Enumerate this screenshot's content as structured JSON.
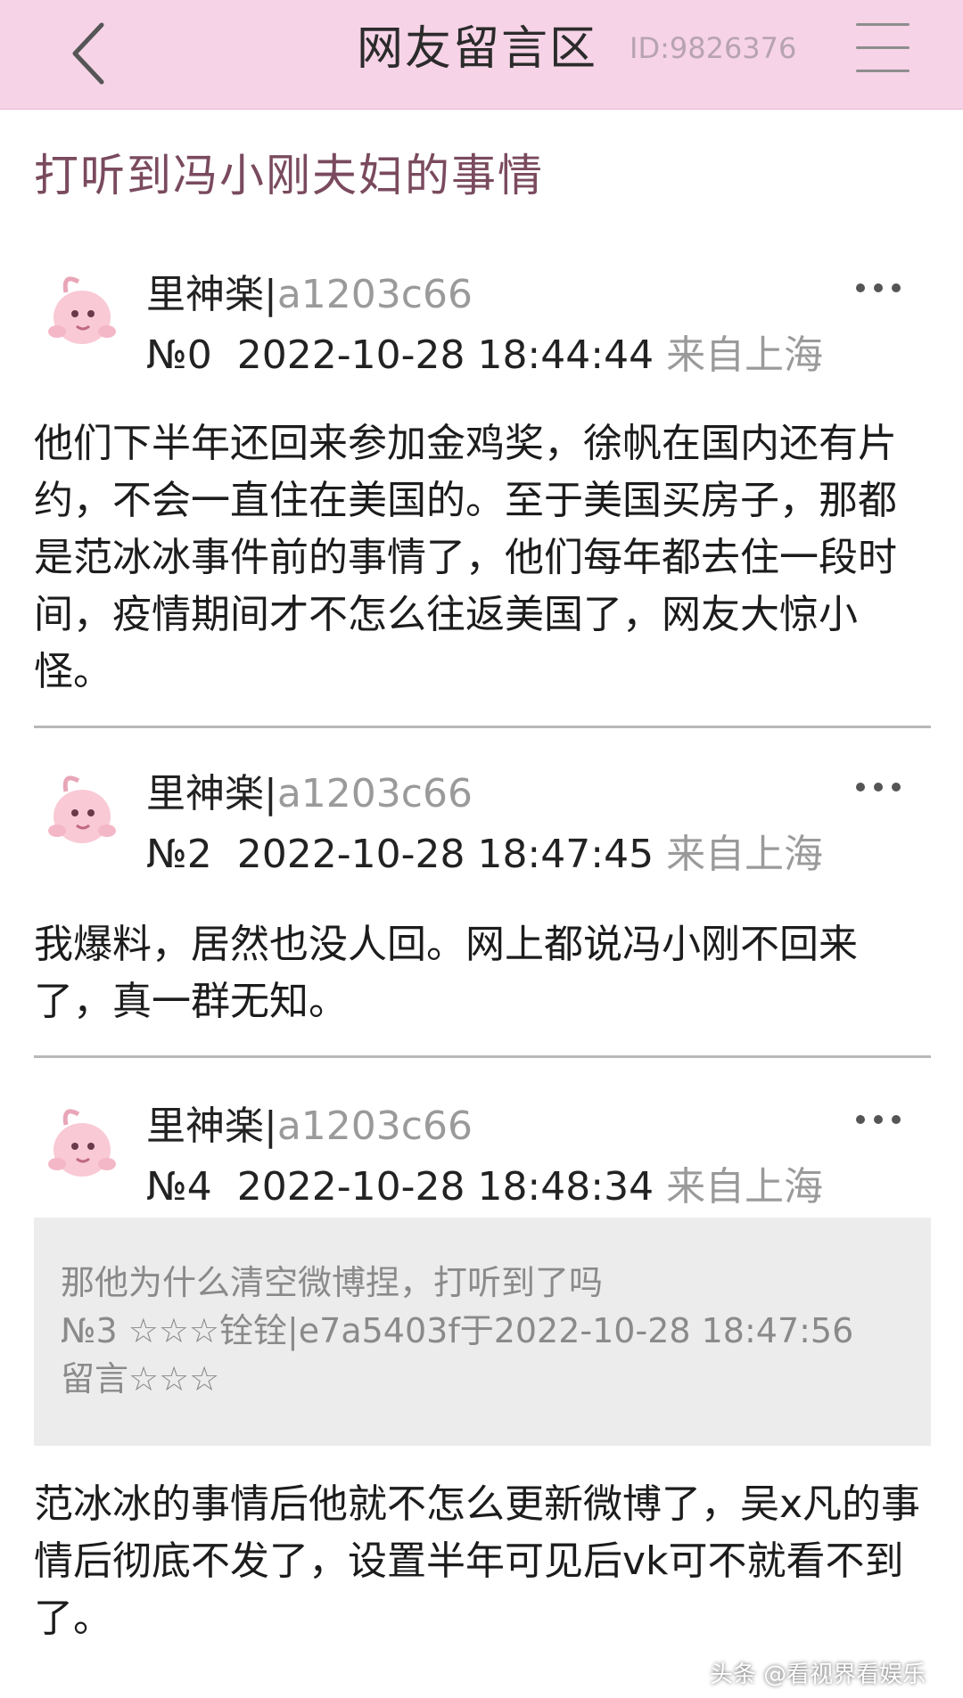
{
  "header": {
    "title": "网友留言区",
    "thread_id": "ID:9826376"
  },
  "thread_title": "打听到冯小刚夫妇的事情",
  "posts": [
    {
      "author": "里神楽",
      "uid": "a1203c66",
      "floor": "№0",
      "time": "2022-10-28 18:44:44",
      "location": "来自上海",
      "body": "他们下半年还回来参加金鸡奖，徐帆在国内还有片约，不会一直住在美国的。至于美国买房子，那都是范冰冰事件前的事情了，他们每年都去住一段时间，疫情期间才不怎么往返美国了，网友大惊小怪。"
    },
    {
      "author": "里神楽",
      "uid": "a1203c66",
      "floor": "№2",
      "time": "2022-10-28 18:47:45",
      "location": "来自上海",
      "body": "我爆料，居然也没人回。网上都说冯小刚不回来了，真一群无知。"
    },
    {
      "author": "里神楽",
      "uid": "a1203c66",
      "floor": "№4",
      "time": "2022-10-28 18:48:34",
      "location": "来自上海",
      "quote": {
        "line1": "那他为什么清空微博捏，打听到了吗",
        "line2": "№3 ☆☆☆铨铨|e7a5403f于2022-10-28 18:47:56",
        "line3": "留言☆☆☆"
      },
      "body": "范冰冰的事情后他就不怎么更新微博了，吴x凡的事情后彻底不发了，设置半年可见后vk可不就看不到了。"
    }
  ],
  "watermark": "头条 @看视界看娱乐",
  "colors": {
    "header_bg": "#f6d3e6",
    "thread_title": "#7a4a5e",
    "muted": "#9a9a9a",
    "quote_bg": "#ececec"
  },
  "icons": {
    "back": "chevron-left-icon",
    "menu": "hamburger-menu-icon",
    "more": "more-dots-icon",
    "avatar": "pink-creature-avatar"
  }
}
